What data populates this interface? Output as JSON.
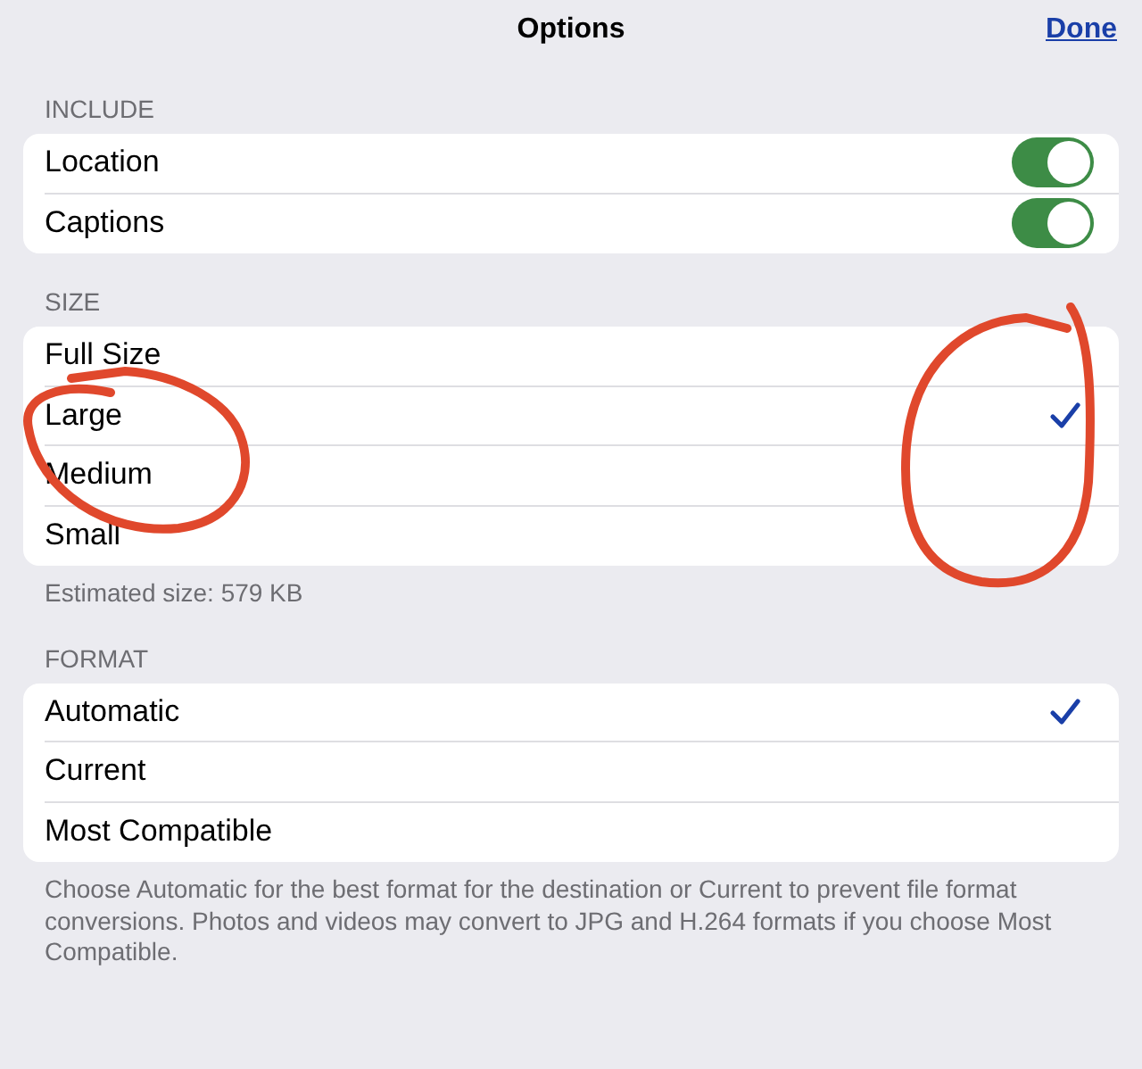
{
  "nav": {
    "title": "Options",
    "done": "Done"
  },
  "sections": [
    {
      "header": "INCLUDE",
      "rows": [
        {
          "kind": "toggle",
          "label": "Location",
          "on": true
        },
        {
          "kind": "toggle",
          "label": "Captions",
          "on": true
        }
      ]
    },
    {
      "header": "SIZE",
      "rows": [
        {
          "kind": "choice",
          "label": "Full Size",
          "selected": false
        },
        {
          "kind": "choice",
          "label": "Large",
          "selected": true
        },
        {
          "kind": "choice",
          "label": "Medium",
          "selected": false
        },
        {
          "kind": "choice",
          "label": "Small",
          "selected": false
        }
      ],
      "footer": "Estimated size: 579 KB"
    },
    {
      "header": "FORMAT",
      "rows": [
        {
          "kind": "choice",
          "label": "Automatic",
          "selected": true
        },
        {
          "kind": "choice",
          "label": "Current",
          "selected": false
        },
        {
          "kind": "choice",
          "label": "Most Compatible",
          "selected": false
        }
      ],
      "footer": "Choose Automatic for the best format for the destination or Current to prevent file format conversions. Photos and videos may convert to JPG and H.264 formats if you choose Most Compatible."
    }
  ],
  "annotations": [
    {
      "kind": "circle",
      "color": "#e0482c"
    },
    {
      "kind": "circle",
      "color": "#e0482c"
    }
  ]
}
